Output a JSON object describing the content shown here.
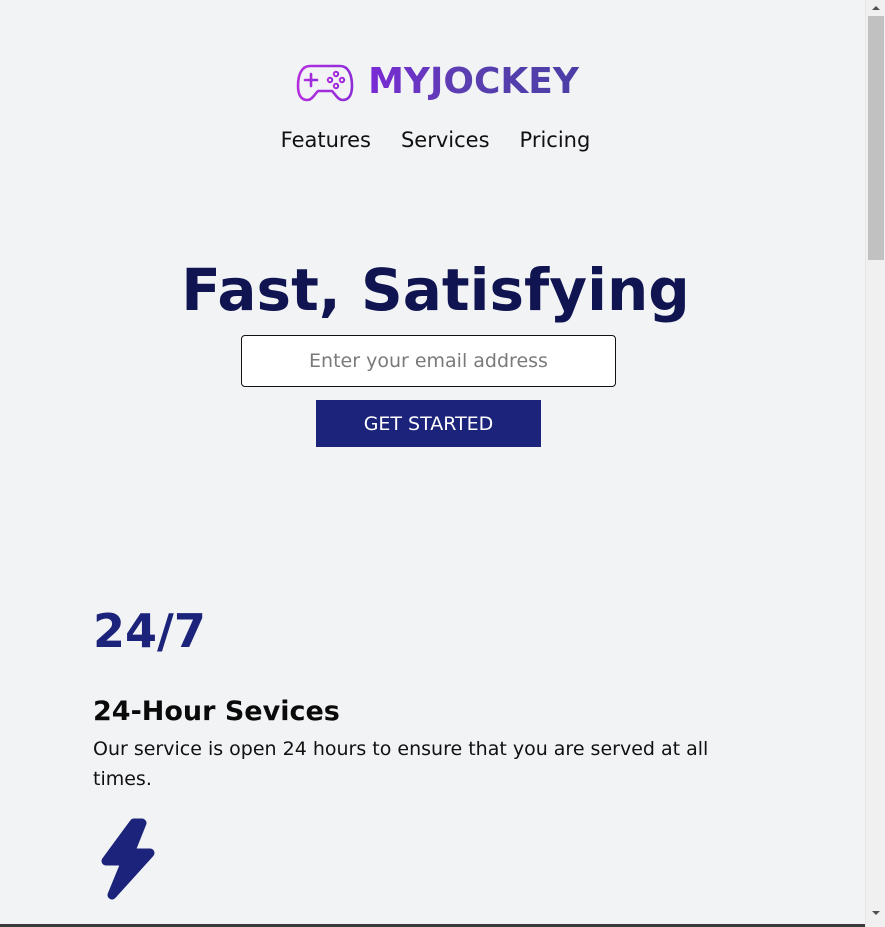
{
  "header": {
    "logo_text": "MYJOCKEY",
    "logo_icon": "gamepad-icon",
    "brand_colors": [
      "#b02bd9",
      "#4b3da6"
    ]
  },
  "nav": {
    "items": [
      {
        "label": "Features"
      },
      {
        "label": "Services"
      },
      {
        "label": "Pricing"
      }
    ]
  },
  "hero": {
    "title": "Fast, Satisfying",
    "email_placeholder": "Enter your email address",
    "cta_label": "GET STARTED"
  },
  "features": [
    {
      "stat": "24/7",
      "title": "24-Hour Sevices",
      "description": "Our service is open 24 hours to ensure that you are served at all times."
    },
    {
      "icon": "lightning-bolt-icon"
    }
  ],
  "colors": {
    "background": "#f2f3f5",
    "primary": "#1b237a",
    "heading": "#101450"
  }
}
